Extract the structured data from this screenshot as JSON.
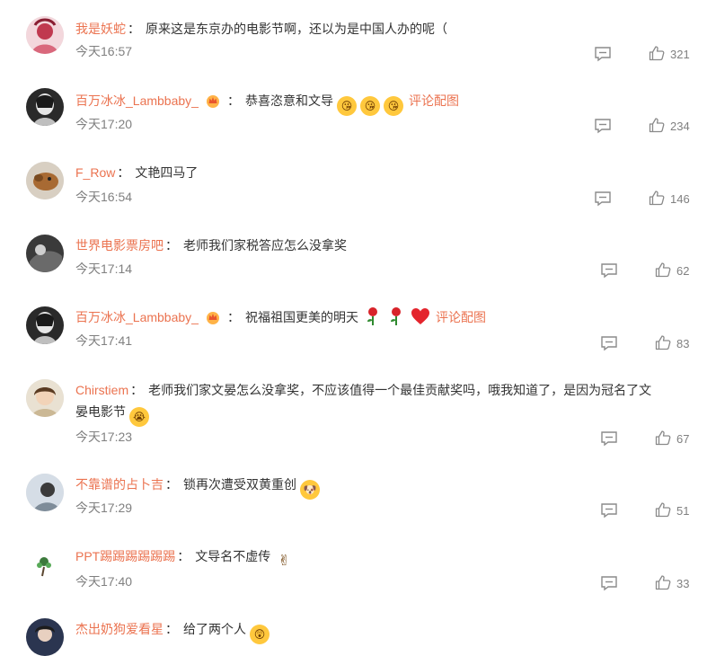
{
  "comments": [
    {
      "user": "我是妖蛇",
      "text": "原来这是东京办的电影节啊，还以为是中国人办的呢（",
      "time": "今天16:57",
      "likes": "321"
    },
    {
      "user": "百万冰冰_Lambbaby_",
      "text": "恭喜恣意和文导",
      "link": "评论配图",
      "time": "今天17:20",
      "likes": "234"
    },
    {
      "user": "F_Row",
      "text": "文艳四马了",
      "time": "今天16:54",
      "likes": "146"
    },
    {
      "user": "世界电影票房吧",
      "text": "老师我们家税答应怎么没拿奖",
      "time": "今天17:14",
      "likes": "62"
    },
    {
      "user": "百万冰冰_Lambbaby_",
      "text": "祝福祖国更美的明天",
      "link": "评论配图",
      "time": "今天17:41",
      "likes": "83"
    },
    {
      "user": "Chirstiem",
      "text_line1": "老师我们家文晏怎么没拿奖，不应该值得一个最佳贡献奖吗，哦我知道了，是因为冠名了文",
      "text_line2": "晏电影节",
      "time": "今天17:23",
      "likes": "67"
    },
    {
      "user": "不靠谱的占卜吉",
      "text": "锁再次遭受双黄重创",
      "time": "今天17:29",
      "likes": "51"
    },
    {
      "user": "PPT踢踢踢踢踢踢",
      "text": "文导名不虚传",
      "time": "今天17:40",
      "likes": "33"
    },
    {
      "user": "杰出奶狗爱看星",
      "text": "给了两个人"
    }
  ],
  "icons": {
    "reply": "comment-bubble-icon",
    "like": "thumbs-up-icon",
    "badge": "crown-vip-badge-icon"
  },
  "colors": {
    "username": "#eb7350",
    "meta": "#808080",
    "text": "#333333"
  }
}
